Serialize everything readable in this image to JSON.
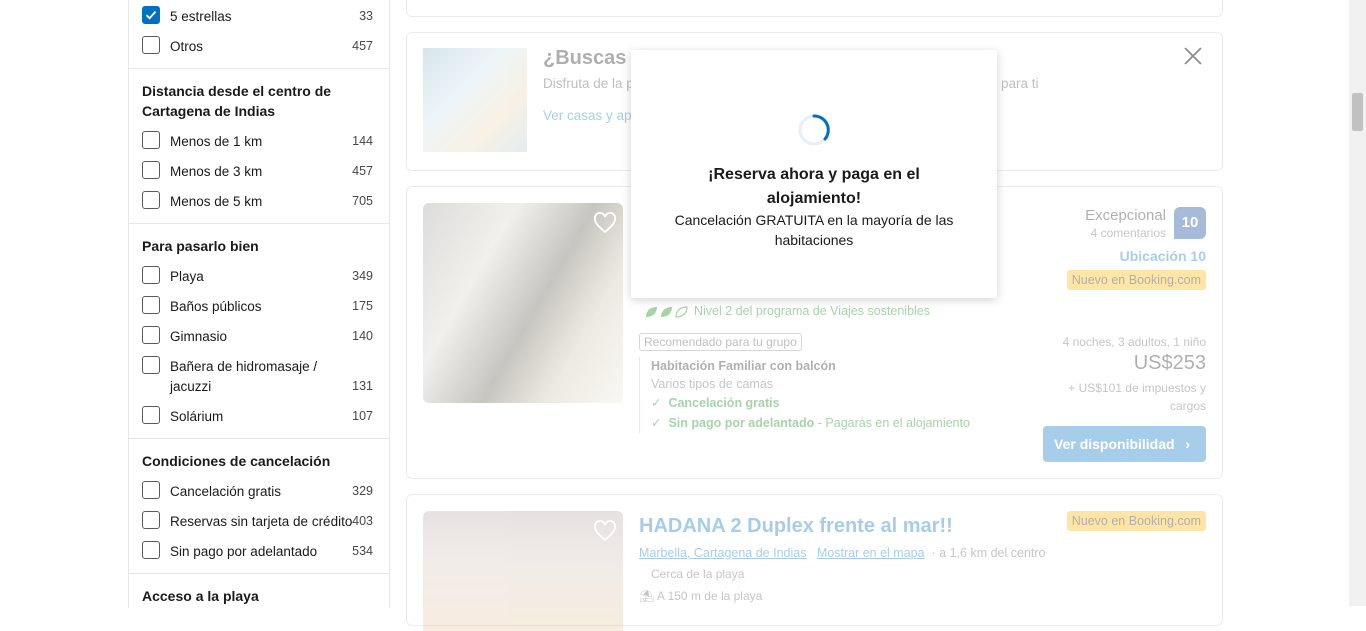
{
  "filters": {
    "stars": [
      {
        "label": "5 estrellas",
        "count": "33",
        "checked": true
      },
      {
        "label": "Otros",
        "count": "457",
        "checked": false
      }
    ],
    "distance": {
      "title": "Distancia desde el centro de Cartagena de Indias",
      "items": [
        {
          "label": "Menos de 1 km",
          "count": "144"
        },
        {
          "label": "Menos de 3 km",
          "count": "457"
        },
        {
          "label": "Menos de 5 km",
          "count": "705"
        }
      ]
    },
    "fun": {
      "title": "Para pasarlo bien",
      "items": [
        {
          "label": "Playa",
          "count": "349"
        },
        {
          "label": "Baños públicos",
          "count": "175"
        },
        {
          "label": "Gimnasio",
          "count": "140"
        },
        {
          "label_line1": "Bañera de hidromasaje /",
          "label_line2": "jacuzzi",
          "count": "131"
        },
        {
          "label": "Solárium",
          "count": "107"
        }
      ]
    },
    "cancellation": {
      "title": "Condiciones de cancelación",
      "items": [
        {
          "label": "Cancelación gratis",
          "count": "329"
        },
        {
          "label": "Reservas sin tarjeta de crédito",
          "count": "403"
        },
        {
          "label": "Sin pago por adelantado",
          "count": "534"
        }
      ]
    },
    "beach_access": {
      "title": "Acceso a la playa"
    }
  },
  "promo": {
    "title": "¿Buscas tu",
    "subtitle_start": "Disfruta de la p",
    "subtitle_end": "para ti",
    "link": "Ver casas y apa"
  },
  "hotel1": {
    "eco": "Nivel 2 del programa de Viajes sostenibles",
    "recommended": "Recomendado para tu grupo",
    "room_name": "Habitación Familiar con balcón",
    "room_beds": "Varios tipos de camas",
    "perk1": "Cancelación gratis",
    "perk2": "Sin pago por adelantado",
    "perk2_note": "- Pagarás en el alojamiento",
    "review_word": "Excepcional",
    "review_count": "4 comentarios",
    "score": "10",
    "location_score": "Ubicación 10",
    "new_badge": "Nuevo en Booking.com",
    "stay": "4 noches, 3 adultos, 1 niño",
    "price": "US$253",
    "taxes": "+ US$101 de impuestos y cargos",
    "button": "Ver disponibilidad"
  },
  "hotel2": {
    "title": "HADANA 2 Duplex frente al mar!!",
    "area": "Marbella, Cartagena de Indias",
    "map_link": "Mostrar en el mapa",
    "distance": "a 1,6 km del centro",
    "beach": "Cerca de la playa",
    "beach_distance": "A 150 m de la playa",
    "new_badge": "Nuevo en Booking.com"
  },
  "modal": {
    "title": "¡Reserva ahora y paga en el alojamiento!",
    "subtitle": "Cancelación GRATUITA en la mayoría de las habitaciones"
  },
  "colors": {
    "accent": "#0071c2",
    "score_bg": "#003b95",
    "green": "#008009",
    "badge": "#ffb700"
  }
}
